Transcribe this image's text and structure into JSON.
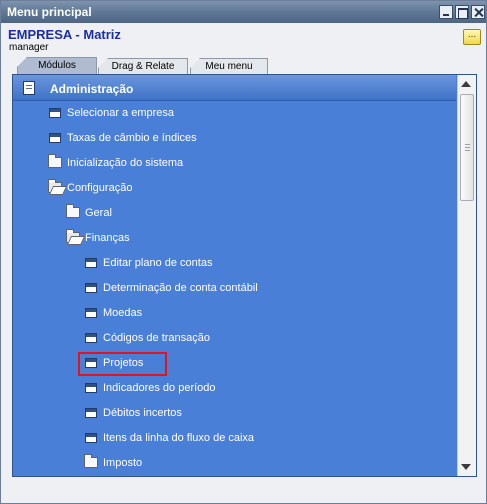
{
  "window": {
    "title": "Menu principal"
  },
  "company": {
    "name": "EMPRESA - Matriz",
    "user": "manager",
    "note_glyph": "..."
  },
  "tabs": [
    {
      "label": "Módulos",
      "active": true
    },
    {
      "label": "Drag & Relate",
      "active": false
    },
    {
      "label": "Meu menu",
      "active": false
    }
  ],
  "panel": {
    "header": "Administração",
    "items": [
      {
        "label": "Selecionar a empresa",
        "icon": "form-icon"
      },
      {
        "label": "Taxas de câmbio e índices",
        "icon": "form-icon"
      },
      {
        "label": "Inicialização do sistema",
        "icon": "folder-icon"
      },
      {
        "label": "Configuração",
        "icon": "folder-open-icon"
      },
      {
        "label": "Geral",
        "icon": "folder-icon"
      },
      {
        "label": "Finanças",
        "icon": "folder-open-icon"
      },
      {
        "label": "Editar plano de contas",
        "icon": "form-icon"
      },
      {
        "label": "Determinação de conta contábil",
        "icon": "form-icon"
      },
      {
        "label": "Moedas",
        "icon": "form-icon"
      },
      {
        "label": "Códigos de transação",
        "icon": "form-icon"
      },
      {
        "label": "Projetos",
        "icon": "form-icon",
        "highlighted": true
      },
      {
        "label": "Indicadores do período",
        "icon": "form-icon"
      },
      {
        "label": "Débitos incertos",
        "icon": "form-icon"
      },
      {
        "label": "Itens da linha do fluxo de caixa",
        "icon": "form-icon"
      },
      {
        "label": "Imposto",
        "icon": "folder-icon"
      }
    ]
  },
  "colors": {
    "panel_bg": "#4a7fd7",
    "highlight": "#e0141e",
    "company_text": "#1a2fa3"
  }
}
